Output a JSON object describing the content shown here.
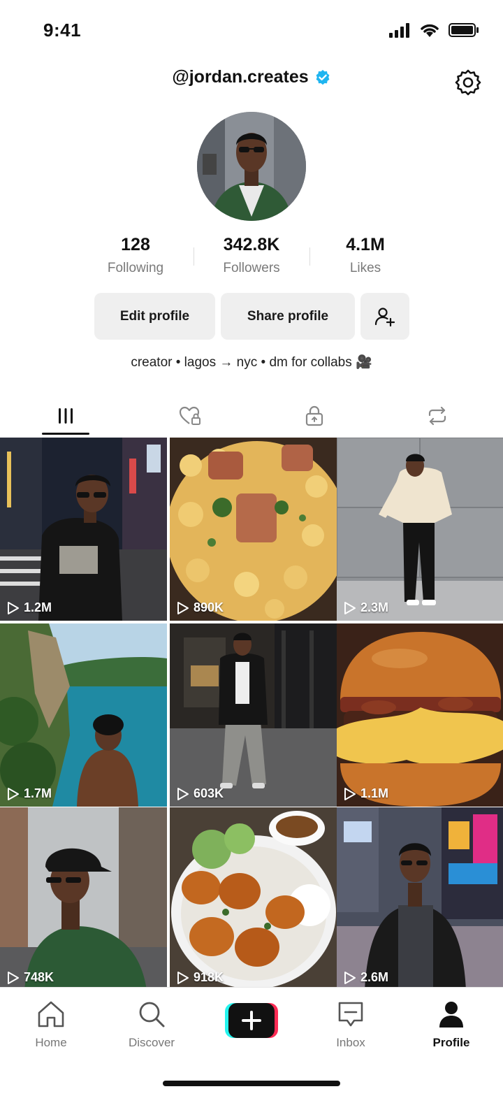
{
  "status_bar": {
    "time": "9:41"
  },
  "profile": {
    "handle": "@jordan.creates",
    "verified": true,
    "stats": [
      {
        "value": "128",
        "label": "Following"
      },
      {
        "value": "342.8K",
        "label": "Followers"
      },
      {
        "value": "4.1M",
        "label": "Likes"
      }
    ],
    "edit_label": "Edit profile",
    "share_label": "Share profile",
    "bio": "creator • lagos → nyc • dm for collabs 🎥"
  },
  "tabs": [
    {
      "name": "videos",
      "icon": "grid-icon",
      "active": true
    },
    {
      "name": "liked",
      "icon": "heart-lock-icon",
      "active": false
    },
    {
      "name": "private",
      "icon": "lock-icon",
      "active": false
    },
    {
      "name": "reposts",
      "icon": "repost-icon",
      "active": false
    }
  ],
  "videos": [
    {
      "views": "1.2M",
      "subject": "city-night-portrait"
    },
    {
      "views": "890K",
      "subject": "mac-and-cheese"
    },
    {
      "views": "2.3M",
      "subject": "cream-jacket-wall"
    },
    {
      "views": "1.7M",
      "subject": "river-cliff"
    },
    {
      "views": "603K",
      "subject": "storefront-outfit"
    },
    {
      "views": "1.1M",
      "subject": "burger"
    },
    {
      "views": "748K",
      "subject": "green-hoodie-street"
    },
    {
      "views": "918K",
      "subject": "shrimp-rice-bowl"
    },
    {
      "views": "2.6M",
      "subject": "times-square"
    }
  ],
  "nav": {
    "home": "Home",
    "discover": "Discover",
    "inbox": "Inbox",
    "profile": "Profile"
  },
  "colors": {
    "verified": "#20b5f0",
    "create_cyan": "#25f4ee",
    "create_pink": "#fe2c55"
  }
}
